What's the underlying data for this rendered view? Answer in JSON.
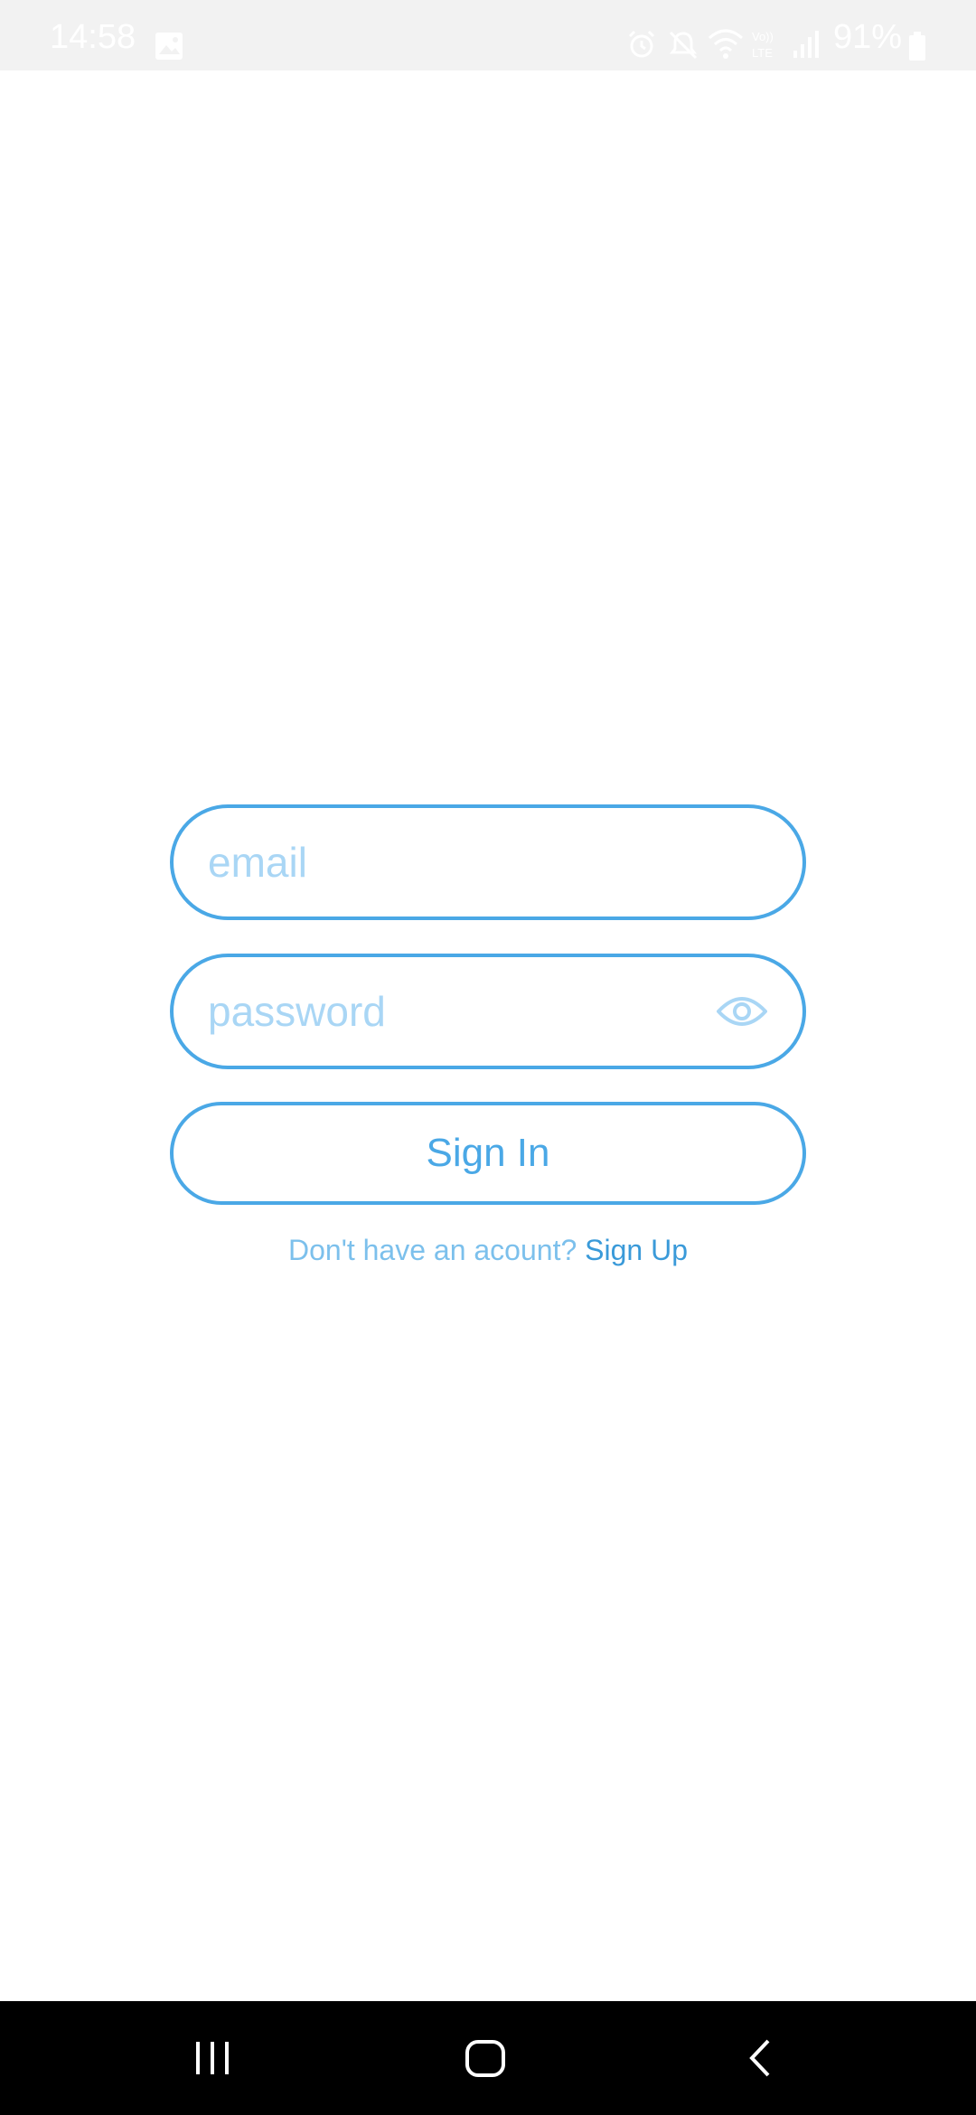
{
  "status_bar": {
    "time": "14:58",
    "battery": "91%",
    "icons": [
      "image-icon",
      "alarm-icon",
      "mute-icon",
      "wifi-icon",
      "volte-icon",
      "signal-icon",
      "battery-icon"
    ]
  },
  "login": {
    "email_placeholder": "email",
    "email_value": "",
    "password_placeholder": "password",
    "password_value": "",
    "sign_in_label": "Sign In",
    "signup_prompt": "Don't have an acount? ",
    "signup_link": "Sign Up"
  },
  "colors": {
    "accent": "#4aa8e6",
    "placeholder": "#a9d6f5",
    "link": "#3a9ad9",
    "status_bar_bg": "#f2f2f2",
    "nav_bar_bg": "#000000"
  },
  "nav_bar": {
    "icons": [
      "recent-apps-icon",
      "home-icon",
      "back-icon"
    ]
  }
}
